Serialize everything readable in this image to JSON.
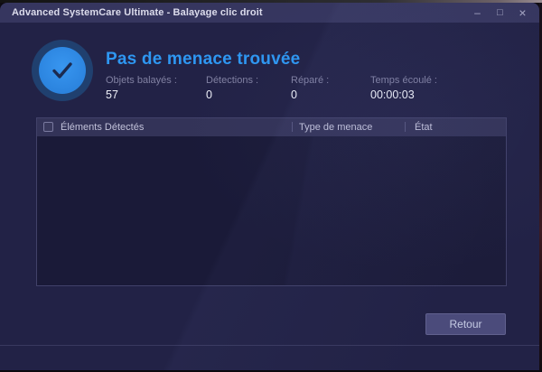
{
  "window": {
    "title": "Advanced SystemCare Ultimate - Balayage clic droit",
    "controls": {
      "minimize_icon": "–",
      "maximize_icon": "□",
      "close_icon": "×"
    }
  },
  "result": {
    "title": "Pas de menace trouvée",
    "stats": [
      {
        "label": "Objets balayés :",
        "value": "57"
      },
      {
        "label": "Détections :",
        "value": "0"
      },
      {
        "label": "Réparé :",
        "value": "0"
      },
      {
        "label": "Temps écoulé :",
        "value": "00:00:03"
      }
    ]
  },
  "table": {
    "columns": [
      "Éléments Détectés",
      "Type de menace",
      "État"
    ],
    "rows": []
  },
  "footer": {
    "back_label": "Retour"
  },
  "colors": {
    "accent_blue": "#2e97f2",
    "success_circle": "#2f8ce8",
    "titlebar": "#36365f",
    "window_bg": "#222246",
    "table_header_bg": "#333358",
    "table_body_bg": "#1b1b39",
    "button_bg": "#4b4b7b"
  }
}
